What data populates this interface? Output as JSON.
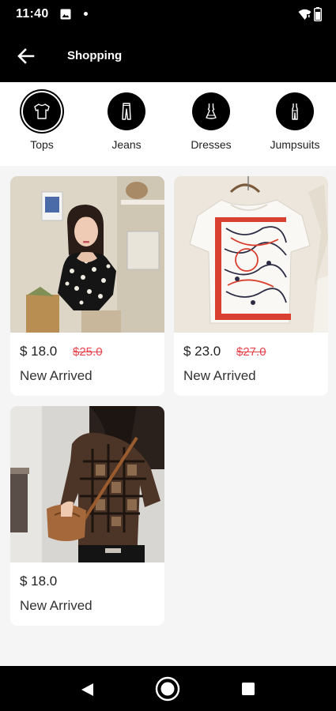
{
  "status_bar": {
    "time": "11:40"
  },
  "app_bar": {
    "title": "Shopping"
  },
  "categories": [
    {
      "label": "Tops",
      "icon": "tshirt-icon",
      "active": true
    },
    {
      "label": "Jeans",
      "icon": "jeans-icon",
      "active": false
    },
    {
      "label": "Dresses",
      "icon": "dress-icon",
      "active": false
    },
    {
      "label": "Jumpsuits",
      "icon": "jumpsuit-icon",
      "active": false
    }
  ],
  "products": [
    {
      "price": "$ 18.0",
      "old_price": "$25.0",
      "tag": "New Arrived"
    },
    {
      "price": "$ 23.0",
      "old_price": "$27.0",
      "tag": "New Arrived"
    },
    {
      "price": "$ 18.0",
      "old_price": "",
      "tag": "New Arrived"
    }
  ],
  "colors": {
    "bar_background": "#000000",
    "page_background": "#f5f5f5",
    "sale_price": "#e8444c"
  }
}
